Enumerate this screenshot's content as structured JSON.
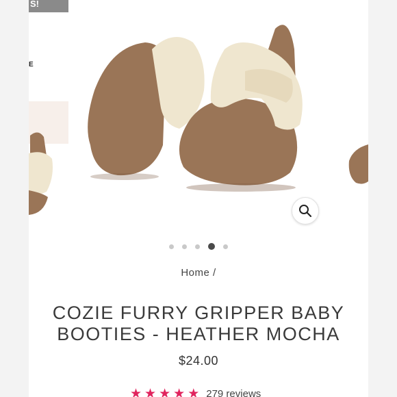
{
  "promo": {
    "tab_text": "S!",
    "side_letter": "E"
  },
  "gallery": {
    "dots": [
      false,
      false,
      false,
      true,
      false
    ]
  },
  "breadcrumb": {
    "home": "Home",
    "separator": "/"
  },
  "product": {
    "title": "COZIE FURRY GRIPPER BABY BOOTIES - HEATHER MOCHA",
    "price": "$24.00"
  },
  "reviews": {
    "rating": 5,
    "text": "279 reviews"
  },
  "colors": {
    "star": "#e0245e",
    "mocha": "#9a7557",
    "sherpa": "#efe6cf"
  }
}
